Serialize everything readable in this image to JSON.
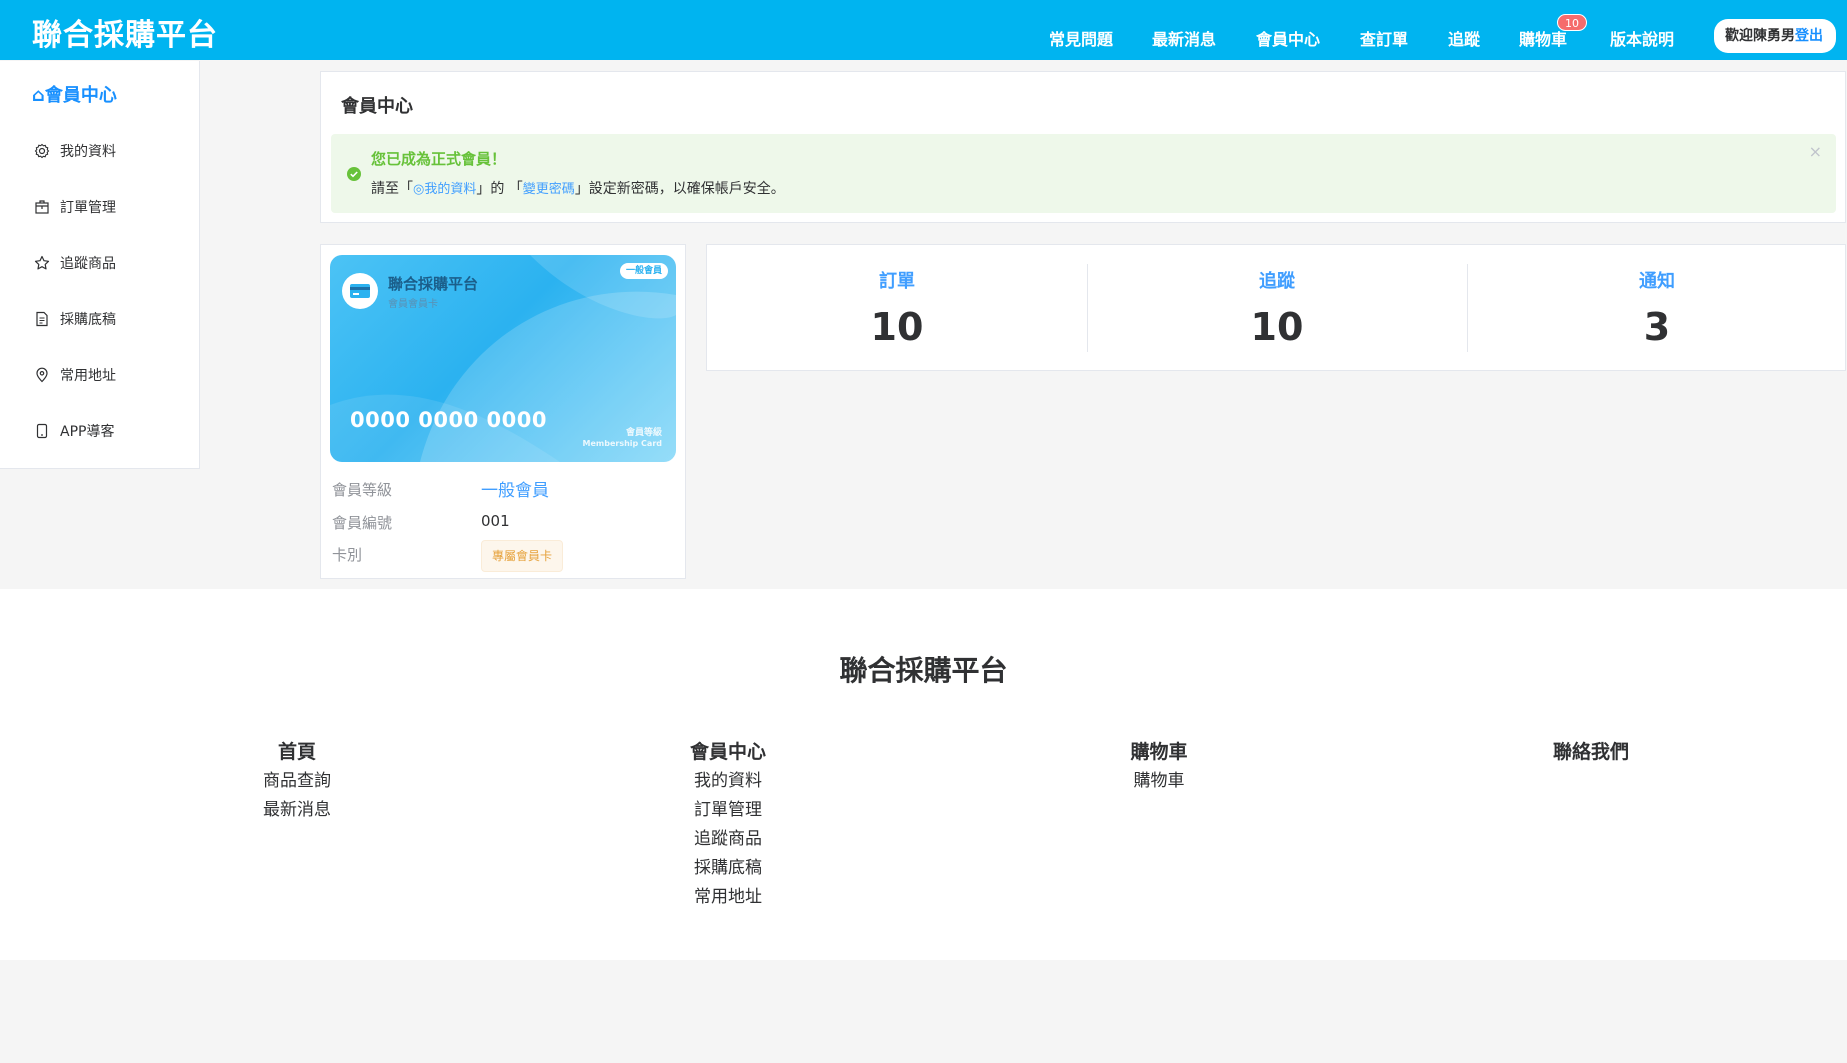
{
  "header": {
    "logo": "聯合採購平台",
    "nav": [
      "常見問題",
      "最新消息",
      "會員中心",
      "查訂單",
      "追蹤",
      "購物車",
      "版本說明"
    ],
    "cart_count": "10",
    "welcome": "歡迎陳勇男",
    "logout": "登出",
    "bg_color": "#00b4f0"
  },
  "sidebar": {
    "title": "⌂會員中心",
    "items": [
      {
        "label": "我的資料",
        "icon": "gear-icon"
      },
      {
        "label": "訂單管理",
        "icon": "box-icon"
      },
      {
        "label": "追蹤商品",
        "icon": "star-icon"
      },
      {
        "label": "採購底稿",
        "icon": "document-icon"
      },
      {
        "label": "常用地址",
        "icon": "location-icon"
      },
      {
        "label": "APP導客",
        "icon": "phone-icon"
      }
    ]
  },
  "member_center": {
    "title": "會員中心",
    "alert": {
      "title": "您已成為正式會員！",
      "text_before": "請至「",
      "link1": "◎我的資料",
      "text_mid": "」的 「",
      "link2": "變更密碼",
      "text_after": "」設定新密碼，以確保帳戶安全。",
      "close": "×"
    }
  },
  "card": {
    "platform": "聯合採購平台",
    "subtitle": "會員會員卡",
    "badge": "一般會員",
    "number": "0000 0000 0000",
    "level_text": "會員等級",
    "english": "Membership Card"
  },
  "member_info": {
    "level_label": "會員等級",
    "level_value": "一般會員",
    "id_label": "會員編號",
    "id_value": "001",
    "type_label": "卡別",
    "type_value": "專屬會員卡"
  },
  "stats": [
    {
      "label": "訂單",
      "value": "10"
    },
    {
      "label": "追蹤",
      "value": "10"
    },
    {
      "label": "通知",
      "value": "3"
    }
  ],
  "footer": {
    "title": "聯合採購平台",
    "columns": [
      {
        "head": "首頁",
        "links": [
          "商品查詢",
          "最新消息"
        ]
      },
      {
        "head": "會員中心",
        "links": [
          "我的資料",
          "訂單管理",
          "追蹤商品",
          "採購底稿",
          "常用地址"
        ]
      },
      {
        "head": "購物車",
        "links": [
          "購物車"
        ]
      },
      {
        "head": "聯絡我們",
        "links": []
      }
    ]
  }
}
